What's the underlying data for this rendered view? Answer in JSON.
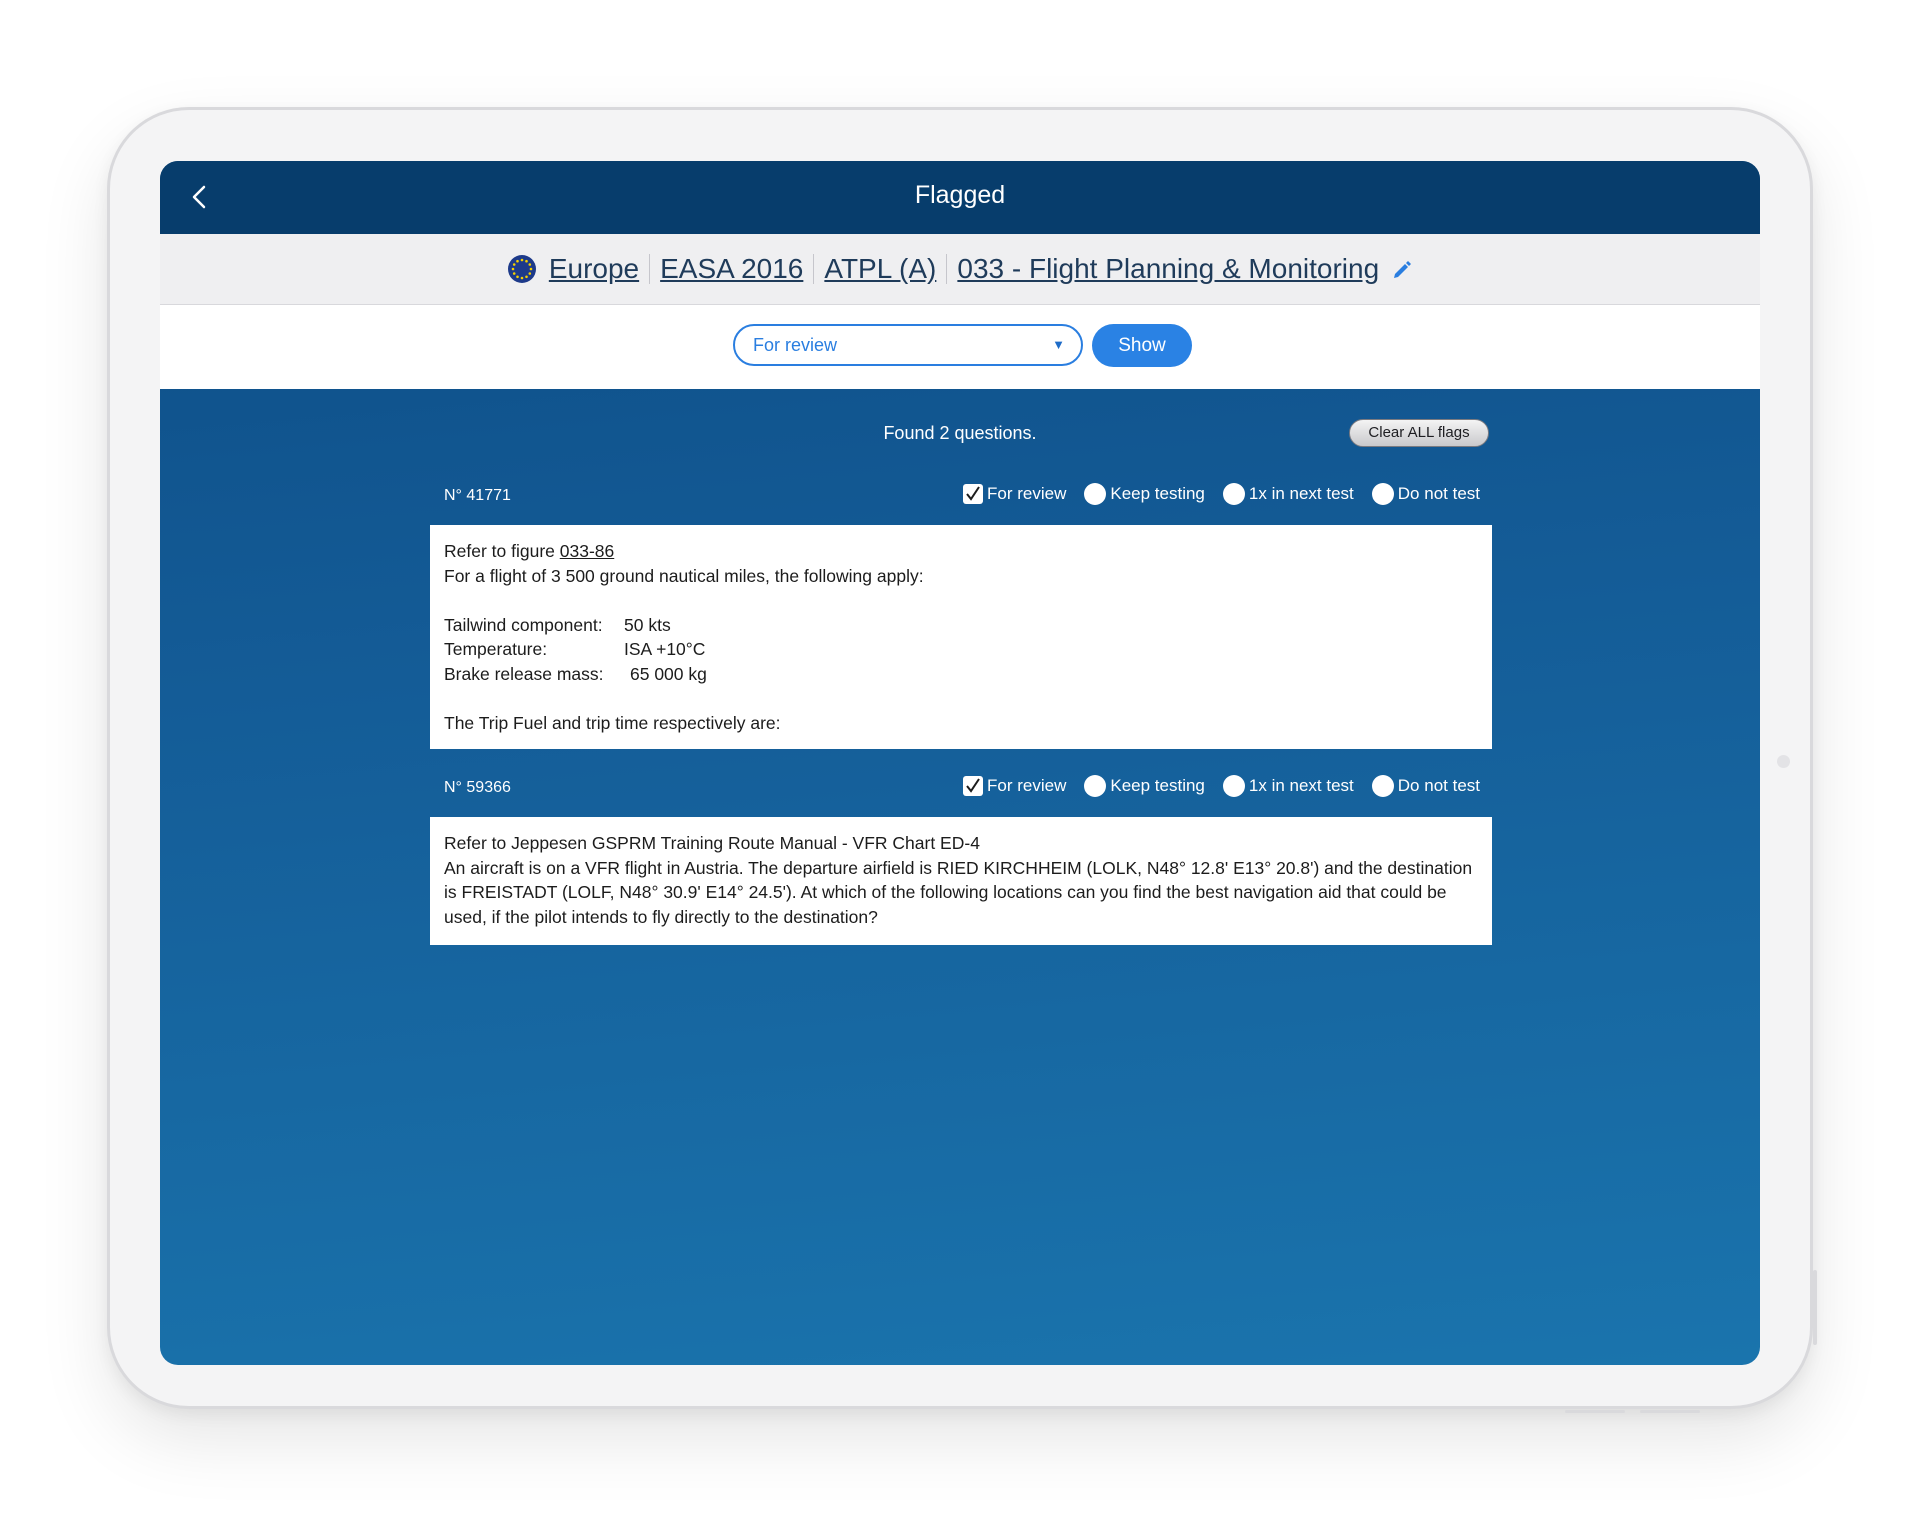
{
  "header": {
    "title": "Flagged",
    "back_icon": "chevron-left-icon"
  },
  "breadcrumb": {
    "flag_icon": "eu-flag-icon",
    "items": [
      "Europe",
      "EASA 2016",
      "ATPL (A)",
      "033 - Flight Planning & Monitoring"
    ],
    "edit_icon": "pencil-icon"
  },
  "filter": {
    "selected": "For review",
    "show_label": "Show"
  },
  "results": {
    "found_text": "Found 2 questions.",
    "clear_label": "Clear ALL flags"
  },
  "flag_options": [
    "For review",
    "Keep testing",
    "1x in next test",
    "Do not test"
  ],
  "questions": [
    {
      "number": "N° 41771",
      "selected_flag": "For review",
      "figure_prefix": "Refer to figure ",
      "figure_link": "033-86",
      "intro": "For a flight of 3 500 ground nautical miles, the following apply:",
      "params": [
        {
          "label": "Tailwind component:",
          "value": "50 kts"
        },
        {
          "label": "Temperature:",
          "value": "ISA +10°C"
        },
        {
          "label": "Brake release mass:",
          "value": "65 000 kg"
        }
      ],
      "question": "The Trip Fuel and trip time respectively are:"
    },
    {
      "number": "N° 59366",
      "selected_flag": "For review",
      "reference": "Refer to Jeppesen GSPRM Training Route Manual - VFR Chart ED-4",
      "text": "An aircraft is on a VFR flight in Austria. The departure airfield is RIED KIRCHHEIM (LOLK, N48° 12.8' E13° 20.8') and the destination is FREISTADT (LOLF, N48° 30.9' E14° 24.5'). At which of the following locations can you find the best navigation aid that could be used, if the pilot intends to fly directly to the destination?"
    }
  ],
  "colors": {
    "titlebar": "#073d6c",
    "accent": "#2a82e4",
    "background_top": "#0d4d86",
    "background_bottom": "#1a74ad"
  }
}
